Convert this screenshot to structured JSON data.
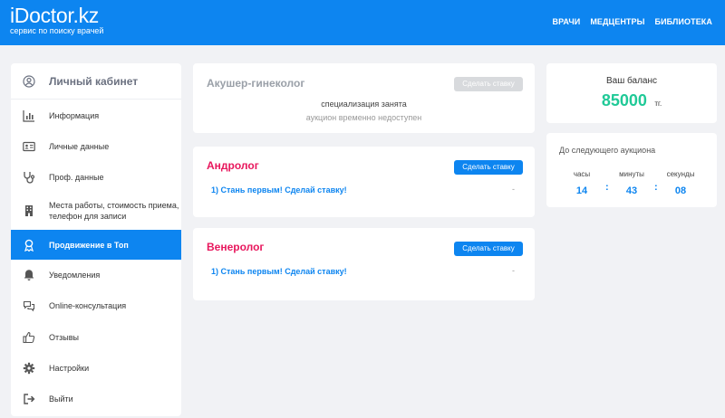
{
  "header": {
    "logo_main": "iDoctor.kz",
    "logo_sub": "сервис по поиску врачей",
    "nav": [
      "ВРАЧИ",
      "МЕДЦЕНТРЫ",
      "БИБЛИОТЕКА"
    ]
  },
  "sidebar": {
    "title": "Личный кабинет",
    "items": [
      {
        "label": "Информация",
        "icon": "chart-icon"
      },
      {
        "label": "Личные данные",
        "icon": "id-card-icon"
      },
      {
        "label": "Проф. данные",
        "icon": "stethoscope-icon"
      },
      {
        "label": "Места работы, стоимость приема, телефон для записи",
        "icon": "building-icon"
      },
      {
        "label": "Продвижение в Топ",
        "icon": "award-icon",
        "active": true
      },
      {
        "label": "Уведомления",
        "icon": "bell-icon"
      },
      {
        "label": "Online-консультация",
        "icon": "chat-icon"
      },
      {
        "label": "Отзывы",
        "icon": "thumbs-up-icon"
      },
      {
        "label": "Настройки",
        "icon": "gear-icon"
      },
      {
        "label": "Выйти",
        "icon": "logout-icon"
      }
    ]
  },
  "auctions": [
    {
      "title": "Акушер-гинеколог",
      "button": "Сделать ставку",
      "status_line1": "специализация занята",
      "status_line2": "аукцион временно недоступен"
    },
    {
      "title": "Андролог",
      "button": "Сделать ставку",
      "bid_text": "1)  Стань первым! Сделай ставку!",
      "bid_value": "-"
    },
    {
      "title": "Венеролог",
      "button": "Сделать ставку",
      "bid_text": "1)  Стань первым! Сделай ставку!",
      "bid_value": "-"
    }
  ],
  "balance": {
    "label": "Ваш баланс",
    "amount": "85000",
    "currency": "тг."
  },
  "timer": {
    "title": "До следующего аукциона",
    "hours_label": "часы",
    "minutes_label": "минуты",
    "seconds_label": "секунды",
    "hours": "14",
    "minutes": "43",
    "seconds": "08"
  },
  "colors": {
    "primary": "#0d85f0",
    "heading_pink": "#e8175d",
    "balance_green": "#20c997",
    "disabled": "#d8dadd"
  }
}
